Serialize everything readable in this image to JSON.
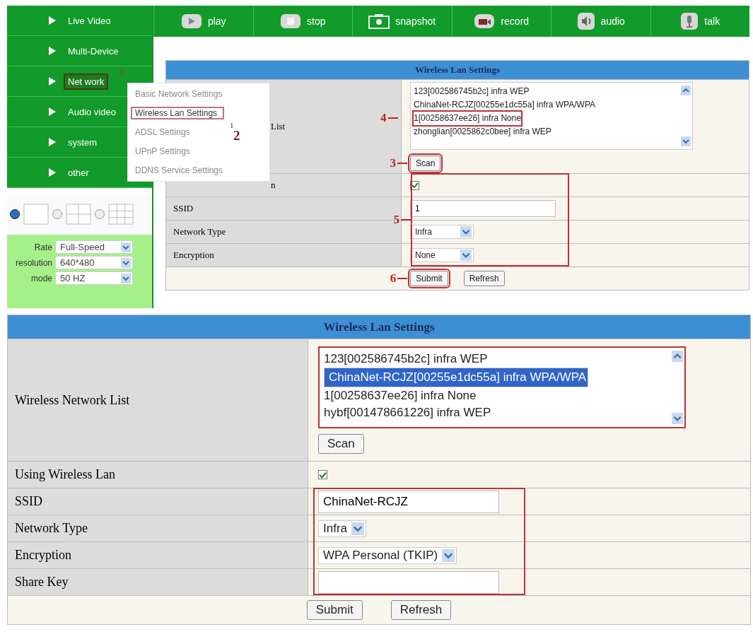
{
  "nav": [
    {
      "label": "Live Video",
      "selected": false
    },
    {
      "label": "Multi-Device",
      "selected": false
    },
    {
      "label": "Net work",
      "selected": true,
      "callout": "1"
    },
    {
      "label": "Audio video",
      "selected": false
    },
    {
      "label": "system",
      "selected": false
    },
    {
      "label": "other",
      "selected": false
    }
  ],
  "toolbar": [
    {
      "kind": "play",
      "label": "play"
    },
    {
      "kind": "stop",
      "label": "stop"
    },
    {
      "kind": "snapshot",
      "label": "snapshot"
    },
    {
      "kind": "record",
      "label": "record"
    },
    {
      "kind": "audio",
      "label": "audio"
    },
    {
      "kind": "talk",
      "label": "talk"
    }
  ],
  "network_menu": [
    {
      "label": "Basic Network Settings",
      "selected": false
    },
    {
      "label": "Wireless Lan Settings",
      "selected": true,
      "callouts": [
        "1",
        "2"
      ]
    },
    {
      "label": "ADSL Settings",
      "selected": false
    },
    {
      "label": "UPnP Settings",
      "selected": false
    },
    {
      "label": "DDNS Service Settings",
      "selected": false
    }
  ],
  "layout_options": [
    {
      "kind": "single",
      "selected": true
    },
    {
      "kind": "quad",
      "selected": false
    },
    {
      "kind": "nine",
      "selected": false
    }
  ],
  "stream_settings": [
    {
      "label": "Rate",
      "value": "Full-Speed"
    },
    {
      "label": "resolution",
      "value": "640*480"
    },
    {
      "label": "mode",
      "value": "50 HZ"
    }
  ],
  "setup_panel": {
    "title": "Wireless Lan Settings",
    "list_label": "List",
    "list_label_covered": true,
    "list_highlighted": false,
    "networks": [
      {
        "text": "123[002586745b2c] infra WEP",
        "selected": false
      },
      {
        "text": "ChinaNet-RCJZ[00255e1dc55a] infra WPA/WPA",
        "selected": false
      },
      {
        "text": "1[00258637ee26] infra None",
        "selected": false,
        "callout": "4"
      },
      {
        "text": "zhonglian[0025862c0bee] infra WEP",
        "selected": false
      }
    ],
    "scan": {
      "label": "Scan",
      "callout": "3"
    },
    "fields_callout": "5",
    "fields": [
      {
        "kind": "checkbox",
        "label": "n",
        "covered": true,
        "checked": true,
        "boxed": true
      },
      {
        "kind": "text",
        "label": "SSID",
        "value": "1",
        "boxed": true
      },
      {
        "kind": "select",
        "label": "Network Type",
        "value": "Infra",
        "boxed": true
      },
      {
        "kind": "select",
        "label": "Encryption",
        "value": "None",
        "boxed": true
      }
    ],
    "buttons": [
      {
        "label": "Submit",
        "callout": "6"
      },
      {
        "label": "Refresh"
      }
    ]
  },
  "result_panel": {
    "title": "Wireless Lan Settings",
    "list_label": "Wireless Network List",
    "list_highlighted": true,
    "networks": [
      {
        "text": "123[002586745b2c] infra WEP",
        "selected": false
      },
      {
        "text": "ChinaNet-RCJZ[00255e1dc55a] infra WPA/WPA",
        "selected": true
      },
      {
        "text": "1[00258637ee26] infra None",
        "selected": false
      },
      {
        "text": "hybf[001478661226] infra WEP",
        "selected": false
      }
    ],
    "scan": {
      "label": "Scan"
    },
    "fields": [
      {
        "kind": "checkbox",
        "label": "Using Wireless Lan",
        "checked": true,
        "boxed": false
      },
      {
        "kind": "text",
        "label": "SSID",
        "value": "ChinaNet-RCJZ",
        "boxed": true
      },
      {
        "kind": "select",
        "label": "Network Type",
        "value": "Infra",
        "boxed": true
      },
      {
        "kind": "select",
        "label": "Encryption",
        "value": "WPA Personal (TKIP)",
        "boxed": true
      },
      {
        "kind": "text",
        "label": "Share Key",
        "boxed": true
      }
    ],
    "buttons": [
      {
        "label": "Submit"
      },
      {
        "label": "Refresh"
      }
    ]
  }
}
